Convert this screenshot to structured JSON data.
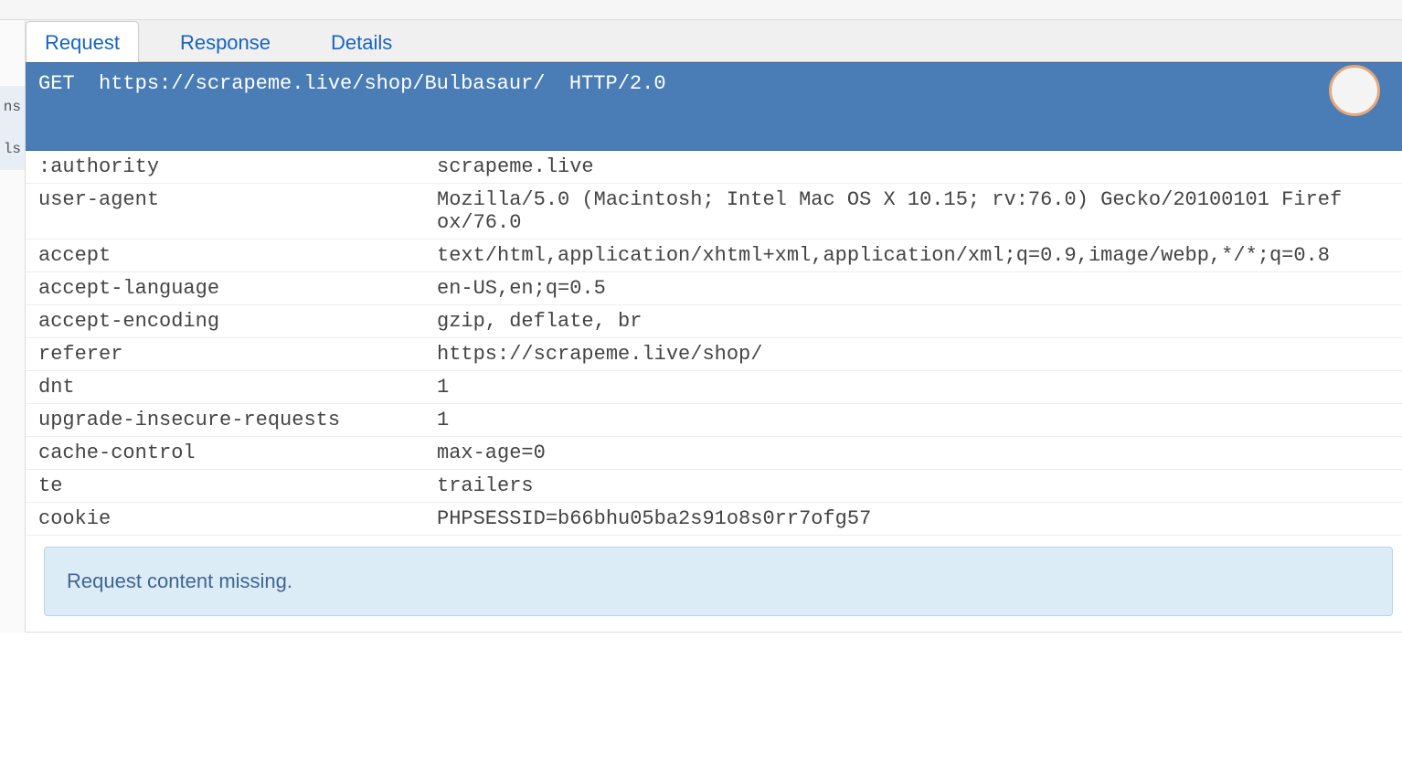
{
  "left_gutter": [
    "ns",
    "ls"
  ],
  "tabs": [
    {
      "label": "Request",
      "active": true
    },
    {
      "label": "Response",
      "active": false
    },
    {
      "label": "Details",
      "active": false
    }
  ],
  "request_line": {
    "method": "GET",
    "url": "https://scrapeme.live/shop/Bulbasaur/",
    "protocol": "HTTP/2.0"
  },
  "headers": [
    {
      "name": ":authority",
      "value": "scrapeme.live"
    },
    {
      "name": "user-agent",
      "value": "Mozilla/5.0 (Macintosh; Intel Mac OS X 10.15; rv:76.0) Gecko/20100101 Firefox/76.0"
    },
    {
      "name": "accept",
      "value": "text/html,application/xhtml+xml,application/xml;q=0.9,image/webp,*/*;q=0.8"
    },
    {
      "name": "accept-language",
      "value": "en-US,en;q=0.5"
    },
    {
      "name": "accept-encoding",
      "value": "gzip, deflate, br"
    },
    {
      "name": "referer",
      "value": "https://scrapeme.live/shop/"
    },
    {
      "name": "dnt",
      "value": "1"
    },
    {
      "name": "upgrade-insecure-requests",
      "value": "1"
    },
    {
      "name": "cache-control",
      "value": "max-age=0"
    },
    {
      "name": "te",
      "value": "trailers"
    },
    {
      "name": "cookie",
      "value": "PHPSESSID=b66bhu05ba2s91o8s0rr7ofg57"
    }
  ],
  "content_message": "Request content missing."
}
